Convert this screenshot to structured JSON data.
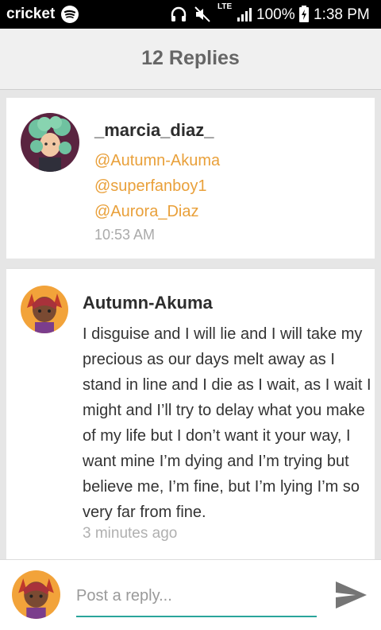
{
  "status_bar": {
    "carrier": "cricket",
    "network": "LTE",
    "battery": "100%",
    "time": "1:38 PM",
    "icons": [
      "spotify-icon",
      "headphones-icon",
      "mute-icon",
      "signal-icon",
      "battery-icon"
    ]
  },
  "header": {
    "title": "12 Replies"
  },
  "replies": [
    {
      "author": "_marcia_diaz_",
      "mentions": [
        "@Autumn-Akuma",
        "@superfanboy1",
        "@Aurora_Diaz"
      ],
      "time": "10:53 AM"
    },
    {
      "author": "Autumn-Akuma",
      "text": "I disguise and I will lie and I will take my precious as our days melt away as I stand in line and I die as I wait, as I wait I might and I’ll try to delay what you make of my life but I don’t want it your way, I want mine I’m dying and I’m trying but believe me, I’m fine, but I’m lying I’m so very far from fine.",
      "time": "3 minutes ago"
    }
  ],
  "reply_bar": {
    "placeholder": "Post a reply..."
  },
  "colors": {
    "mention": "#e9a03a",
    "accent": "#2aa59b",
    "header_bg": "#f0f0f0"
  }
}
